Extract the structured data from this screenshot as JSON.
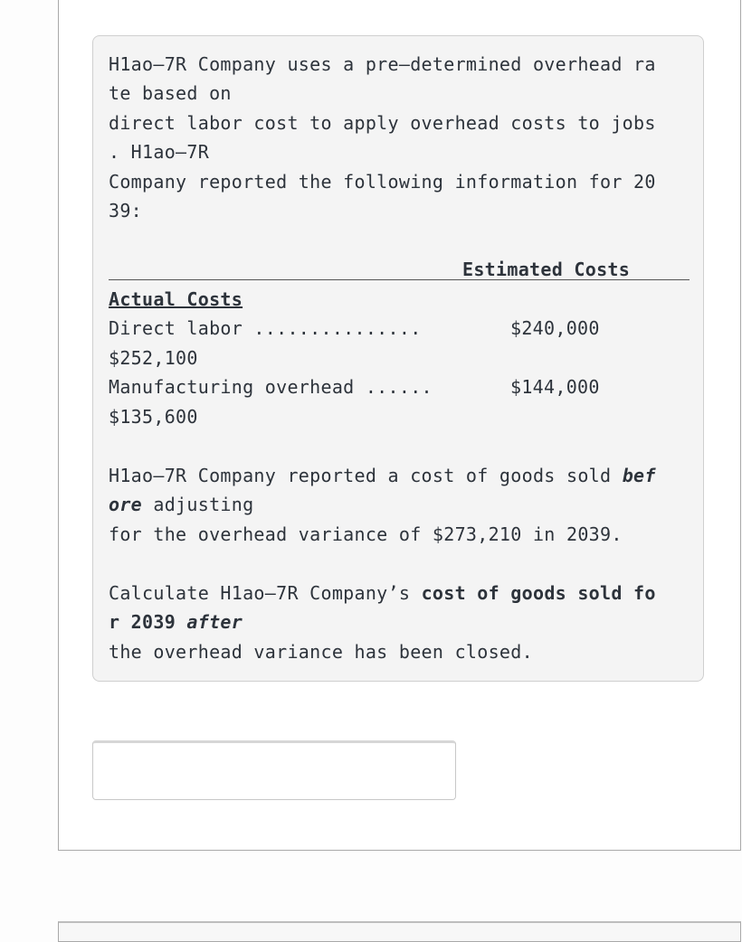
{
  "intro": {
    "line1": "H1ao–7R Company uses a pre–determined overhead ra",
    "line2": "te based on",
    "line3": "direct labor cost to apply overhead costs to jobs",
    "line4": ". H1ao–7R",
    "line5": "Company reported the following information for 20",
    "line6": "39:"
  },
  "table": {
    "estimated_header": "Estimated Costs",
    "actual_header": "Actual Costs",
    "rows": [
      {
        "label": "Direct labor ...............",
        "estimated": "$240,000",
        "actual": "$252,100"
      },
      {
        "label": "Manufacturing overhead ......",
        "estimated": "$144,000",
        "actual": "$135,600"
      }
    ]
  },
  "cogs": {
    "prefix": "H1ao–7R Company reported a cost of goods sold ",
    "bold1": "bef",
    "bold2": "ore",
    "line2_rest": " adjusting",
    "line3": "for the overhead variance of $273,210 in 2039."
  },
  "question": {
    "prefix": "Calculate H1ao–7R Company’s ",
    "bold1": "cost of goods sold fo",
    "bold2": "r 2039 ",
    "italic": "after",
    "line3": "the overhead variance has been closed."
  },
  "answer": {
    "value": ""
  }
}
